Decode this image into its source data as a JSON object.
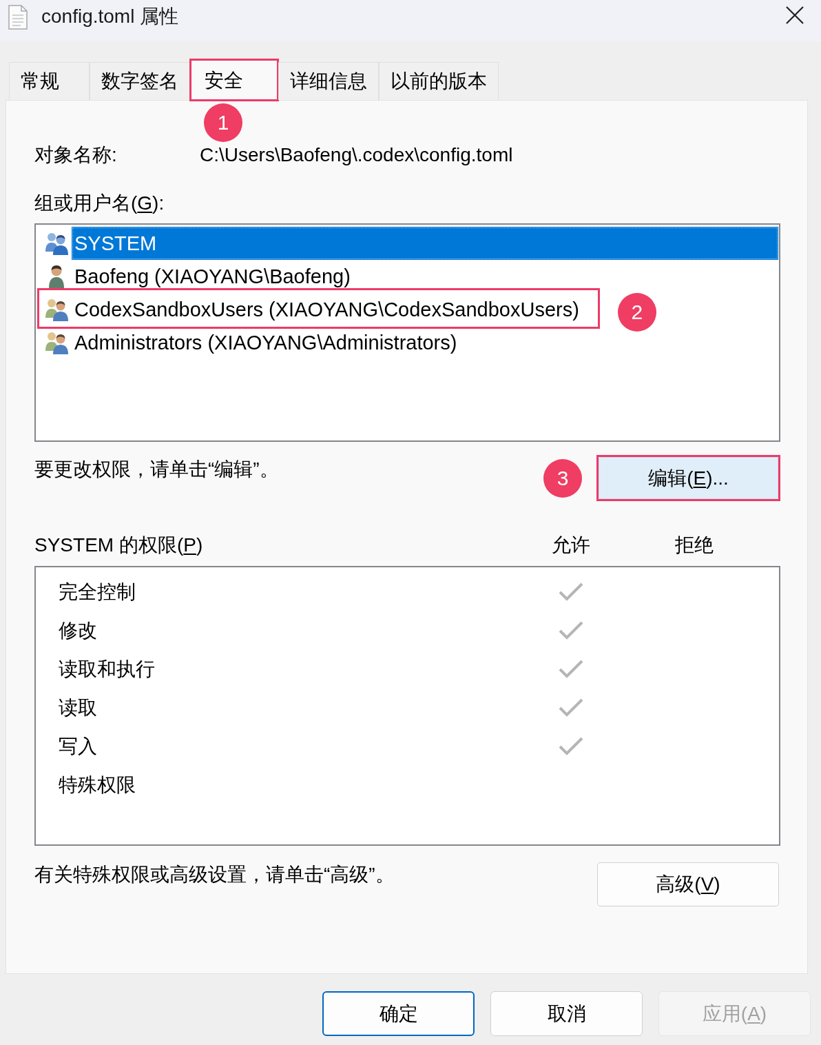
{
  "window": {
    "title": "config.toml 属性"
  },
  "tabs": [
    {
      "label": "常规",
      "selected": false
    },
    {
      "label": "数字签名",
      "selected": false
    },
    {
      "label": "安全",
      "selected": true,
      "callout": "1"
    },
    {
      "label": "详细信息",
      "selected": false
    },
    {
      "label": "以前的版本",
      "selected": false
    }
  ],
  "object_name": {
    "label": "对象名称:",
    "value": "C:\\Users\\Baofeng\\.codex\\config.toml"
  },
  "groups": {
    "label": {
      "text": "组或用户名(",
      "key": "G",
      "tail": "):"
    },
    "items": [
      {
        "name": "SYSTEM",
        "kind": "group",
        "selected": true
      },
      {
        "name": "Baofeng (XIAOYANG\\Baofeng)",
        "kind": "user",
        "selected": false
      },
      {
        "name": "CodexSandboxUsers (XIAOYANG\\CodexSandboxUsers)",
        "kind": "group",
        "selected": false,
        "callout": "2"
      },
      {
        "name": "Administrators (XIAOYANG\\Administrators)",
        "kind": "group",
        "selected": false
      }
    ]
  },
  "edit_hint": "要更改权限，请单击“编辑”。",
  "edit_button": {
    "label": {
      "text": "编辑(",
      "key": "E",
      "tail": ")..."
    },
    "hovered": true,
    "callout": "3"
  },
  "permissions": {
    "label": {
      "text": "SYSTEM 的权限(",
      "key": "P",
      "tail": ")"
    },
    "columns": [
      "允许",
      "拒绝"
    ],
    "rows": [
      {
        "name": "完全控制",
        "allow": true,
        "deny": false
      },
      {
        "name": "修改",
        "allow": true,
        "deny": false
      },
      {
        "name": "读取和执行",
        "allow": true,
        "deny": false
      },
      {
        "name": "读取",
        "allow": true,
        "deny": false
      },
      {
        "name": "写入",
        "allow": true,
        "deny": false
      },
      {
        "name": "特殊权限",
        "allow": false,
        "deny": false
      }
    ]
  },
  "advanced_hint": "有关特殊权限或高级设置，请单击“高级”。",
  "advanced_button": {
    "label": {
      "text": "高级(",
      "key": "V",
      "tail": ")"
    }
  },
  "buttons": [
    {
      "label": {
        "text": "确定"
      },
      "default": true,
      "disabled": false
    },
    {
      "label": {
        "text": "取消"
      },
      "default": false,
      "disabled": false
    },
    {
      "label": {
        "text": "应用(",
        "key": "A",
        "tail": ")"
      },
      "default": false,
      "disabled": true
    }
  ]
}
